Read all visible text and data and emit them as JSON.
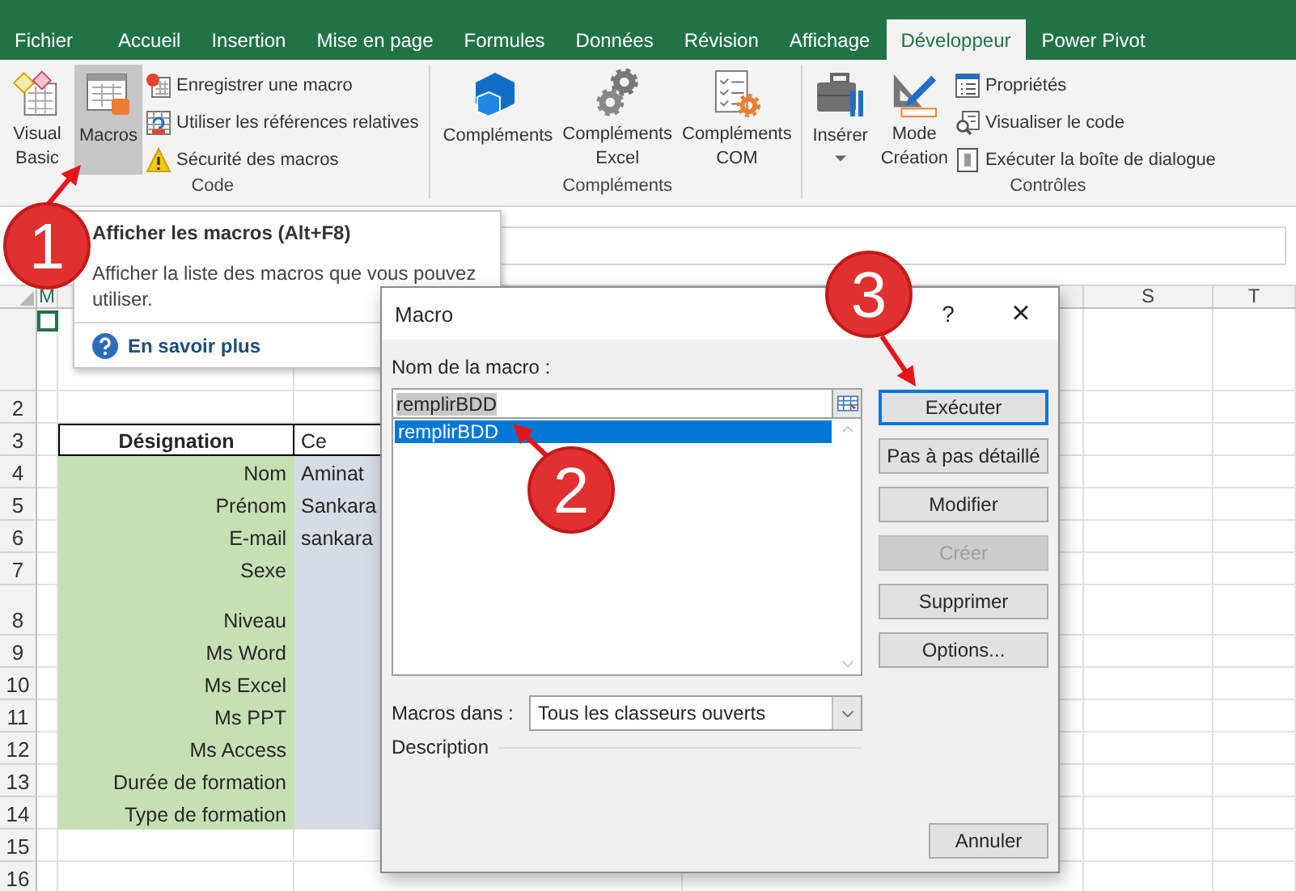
{
  "tabs": [
    {
      "label": "Fichier",
      "selected": false
    },
    {
      "label": "Accueil",
      "selected": false
    },
    {
      "label": "Insertion",
      "selected": false
    },
    {
      "label": "Mise en page",
      "selected": false
    },
    {
      "label": "Formules",
      "selected": false
    },
    {
      "label": "Données",
      "selected": false
    },
    {
      "label": "Révision",
      "selected": false
    },
    {
      "label": "Affichage",
      "selected": false
    },
    {
      "label": "Développeur",
      "selected": true
    },
    {
      "label": "Power Pivot",
      "selected": false
    }
  ],
  "ribbon": {
    "groups": [
      {
        "label": "Code",
        "large_buttons": [
          {
            "label": "Visual\nBasic",
            "selected": false,
            "dropdown": false
          },
          {
            "label": "Macros",
            "selected": true,
            "dropdown": false
          }
        ],
        "small_buttons": [
          "Enregistrer une macro",
          "Utiliser les références relatives",
          "Sécurité des macros"
        ]
      },
      {
        "label": "Compléments",
        "large_buttons": [
          {
            "label": "Compléments",
            "selected": false,
            "dropdown": false
          },
          {
            "label": "Compléments\nExcel",
            "selected": false,
            "dropdown": false
          },
          {
            "label": "Compléments\nCOM",
            "selected": false,
            "dropdown": false
          }
        ]
      },
      {
        "label": "Contrôles",
        "large_buttons": [
          {
            "label": "Insérer",
            "selected": false,
            "dropdown": true
          },
          {
            "label": "Mode\nCréation",
            "selected": false,
            "dropdown": false
          }
        ],
        "small_buttons": [
          "Propriétés",
          "Visualiser le code",
          "Exécuter la boîte de dialogue"
        ]
      }
    ]
  },
  "tooltip": {
    "title": "Afficher les macros (Alt+F8)",
    "description": "Afficher la liste des macros que vous pouvez utiliser.",
    "link": "En savoir plus"
  },
  "sheet": {
    "column_headers": [
      {
        "label": "M"
      },
      {
        "label": "S"
      },
      {
        "label": "T"
      }
    ],
    "rows": [
      {
        "kind": "active"
      },
      {
        "number": "2",
        "kind": "blank"
      },
      {
        "number": "3",
        "kind": "header",
        "heading": "Désignation",
        "heading_2": "Ce"
      },
      {
        "number": "4",
        "kind": "field",
        "label": "Nom",
        "value": "Aminat"
      },
      {
        "number": "5",
        "kind": "field",
        "label": "Prénom",
        "value": "Sankara"
      },
      {
        "number": "6",
        "kind": "field",
        "label": "E-mail",
        "value": "sankara"
      },
      {
        "number": "7",
        "kind": "field",
        "label": "Sexe"
      },
      {
        "number": "8",
        "kind": "field",
        "label": "Niveau"
      },
      {
        "number": "9",
        "kind": "field",
        "label": "Ms Word"
      },
      {
        "number": "10",
        "kind": "field",
        "label": "Ms Excel"
      },
      {
        "number": "11",
        "kind": "field",
        "label": "Ms PPT"
      },
      {
        "number": "12",
        "kind": "field",
        "label": "Ms Access"
      },
      {
        "number": "13",
        "kind": "field",
        "label": "Durée de formation"
      },
      {
        "number": "14",
        "kind": "field",
        "label": "Type de formation"
      },
      {
        "number": "15",
        "kind": "blank"
      },
      {
        "number": "16",
        "kind": "blank"
      }
    ]
  },
  "dialog": {
    "title": "Macro",
    "help": "?",
    "close": "×",
    "name_label": "Nom de la macro :",
    "name_value": "remplirBDD",
    "macros": [
      {
        "label": "remplirBDD",
        "selected": true
      }
    ],
    "location_label": "Macros dans :",
    "location_value": "Tous les classeurs ouverts",
    "description_label": "Description",
    "buttons": [
      {
        "label": "Exécuter",
        "default": true,
        "disabled": false
      },
      {
        "label": "Pas à pas détaillé",
        "default": false,
        "disabled": false
      },
      {
        "label": "Modifier",
        "default": false,
        "disabled": false
      },
      {
        "label": "Créer",
        "default": false,
        "disabled": true
      },
      {
        "label": "Supprimer",
        "default": false,
        "disabled": false
      },
      {
        "label": "Options...",
        "default": false,
        "disabled": false
      }
    ],
    "cancel": "Annuler"
  },
  "callouts": [
    {
      "number": "1"
    },
    {
      "number": "2"
    },
    {
      "number": "3"
    }
  ]
}
